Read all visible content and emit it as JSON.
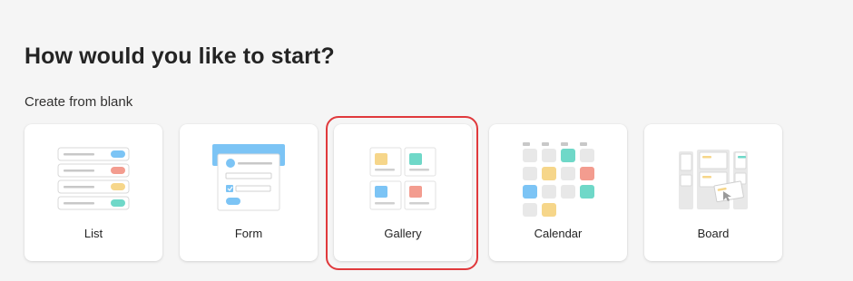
{
  "page": {
    "heading": "How would you like to start?",
    "subheading": "Create from blank"
  },
  "templates": [
    {
      "label": "List",
      "icon": "list-icon"
    },
    {
      "label": "Form",
      "icon": "form-icon"
    },
    {
      "label": "Gallery",
      "icon": "gallery-icon",
      "highlighted": true
    },
    {
      "label": "Calendar",
      "icon": "calendar-icon"
    },
    {
      "label": "Board",
      "icon": "board-icon"
    }
  ],
  "colors": {
    "blue": "#7cc4f5",
    "red": "#f39c8f",
    "yellow": "#f6d68a",
    "teal": "#6fd8c8",
    "gray": "#e8e8e8",
    "highlight_ring": "#e0393c"
  }
}
